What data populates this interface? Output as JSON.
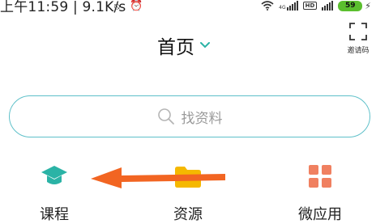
{
  "status_bar": {
    "time_and_speed": "上午11:59 | 9.1K/s",
    "network_1": "4G",
    "hd_label": "HD",
    "battery_level": "59"
  },
  "header": {
    "title": "首页",
    "scan_label": "邀请码"
  },
  "search": {
    "placeholder": "找资料"
  },
  "shortcuts": [
    {
      "label": "课程",
      "icon": "graduation-cap-icon",
      "color": "#2bb3a6"
    },
    {
      "label": "资源",
      "icon": "folder-icon",
      "color": "#f5b800"
    },
    {
      "label": "微应用",
      "icon": "grid-apps-icon",
      "color": "#f08060"
    }
  ],
  "annotation": {
    "arrow_color": "#f26522"
  }
}
